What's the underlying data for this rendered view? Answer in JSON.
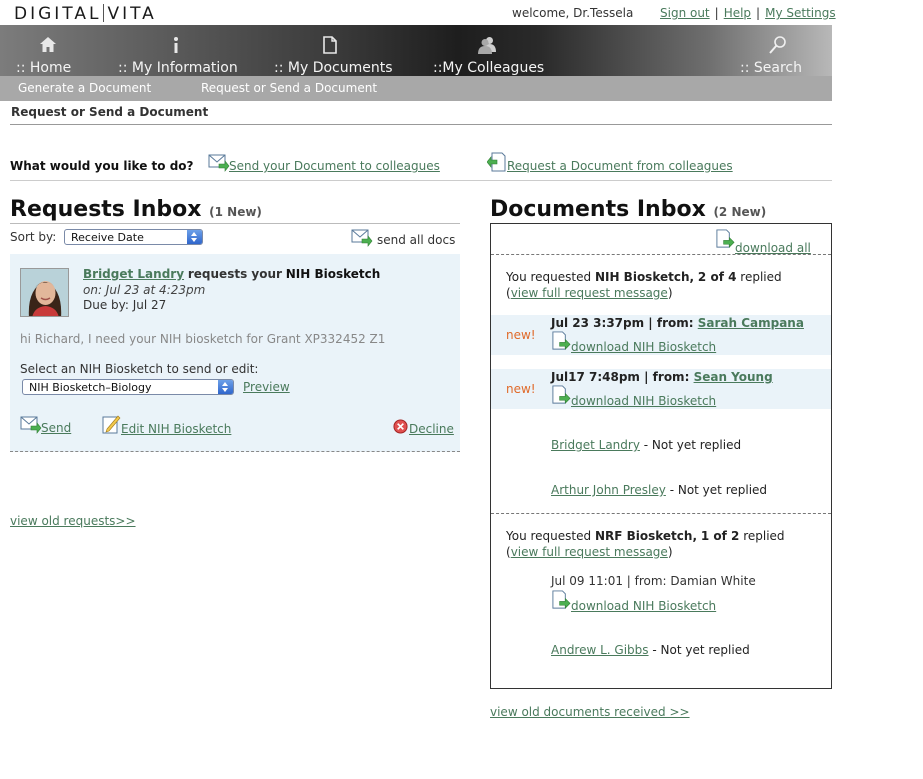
{
  "header": {
    "logo_left": "DIGITAL",
    "logo_right": "VITA",
    "welcome": "welcome, Dr.Tessela",
    "links": [
      "Sign out",
      "Help",
      "My Settings"
    ],
    "sep": "|"
  },
  "nav": {
    "items": [
      {
        "label": ":: Home",
        "icon": "home-icon"
      },
      {
        "label": ":: My Information",
        "icon": "info-icon"
      },
      {
        "label": ":: My Documents",
        "icon": "document-icon"
      },
      {
        "label": "::My Colleagues",
        "icon": "colleagues-icon"
      },
      {
        "label": ":: Search",
        "icon": "search-icon"
      }
    ],
    "sub": [
      "Generate a Document",
      "Request or Send a Document"
    ]
  },
  "page": {
    "breadcrumb": "Request or Send a Document",
    "question": "What would you like to do?",
    "send_link": "Send your Document to colleagues",
    "request_link": "Request a Document from colleagues"
  },
  "requests": {
    "title": "Requests Inbox",
    "count": "(1 New)",
    "sort_label": "Sort by:",
    "sort_value": "Receive Date",
    "send_all": "send all docs",
    "item": {
      "name": "Bridget Landry",
      "requests_text": "requests your",
      "doc": "NIH Biosketch",
      "on": "on: Jul 23 at 4:23pm",
      "due": "Due by: Jul 27",
      "message": "hi Richard, I need your NIH biosketch for Grant XP332452 Z1",
      "select_label": "Select an NIH Biosketch to send or edit:",
      "select_value": "NIH Biosketch–Biology",
      "preview": "Preview",
      "send": "Send",
      "edit": "Edit NIH Biosketch",
      "decline": "Decline"
    },
    "view_old": "view old requests>>"
  },
  "documents": {
    "title": "Documents Inbox",
    "count": "(2 New)",
    "download_all": "download all",
    "view_full": "view full request message",
    "groups": [
      {
        "prefix": "You requested",
        "doc": "NIH Biosketch",
        "status": "2 of 4",
        "suffix": "replied",
        "replies": [
          {
            "new": "new!",
            "date": "Jul 23 3:37pm | from:",
            "from": "Sarah Campana",
            "download": "download NIH Biosketch"
          },
          {
            "new": "new!",
            "date": "Jul17 7:48pm | from:",
            "from": "Sean Young",
            "download": "download NIH Biosketch"
          }
        ],
        "pending": [
          {
            "name": "Bridget Landry",
            "note": "- Not yet replied"
          },
          {
            "name": "Arthur John Presley",
            "note": "- Not yet replied"
          }
        ]
      },
      {
        "prefix": "You requested",
        "doc": "NRF Biosketch",
        "status": "1 of 2",
        "suffix": "replied",
        "replies": [
          {
            "date": "Jul 09 11:01 | from: Damian White",
            "download": "download NIH Biosketch"
          }
        ],
        "pending": [
          {
            "name": "Andrew L. Gibbs",
            "note": "- Not yet replied"
          }
        ]
      }
    ],
    "view_old": "view old documents received >>"
  },
  "colors": {
    "link": "#4a7a5c",
    "new": "#e06a2a",
    "highlight": "#eaf3f9"
  }
}
